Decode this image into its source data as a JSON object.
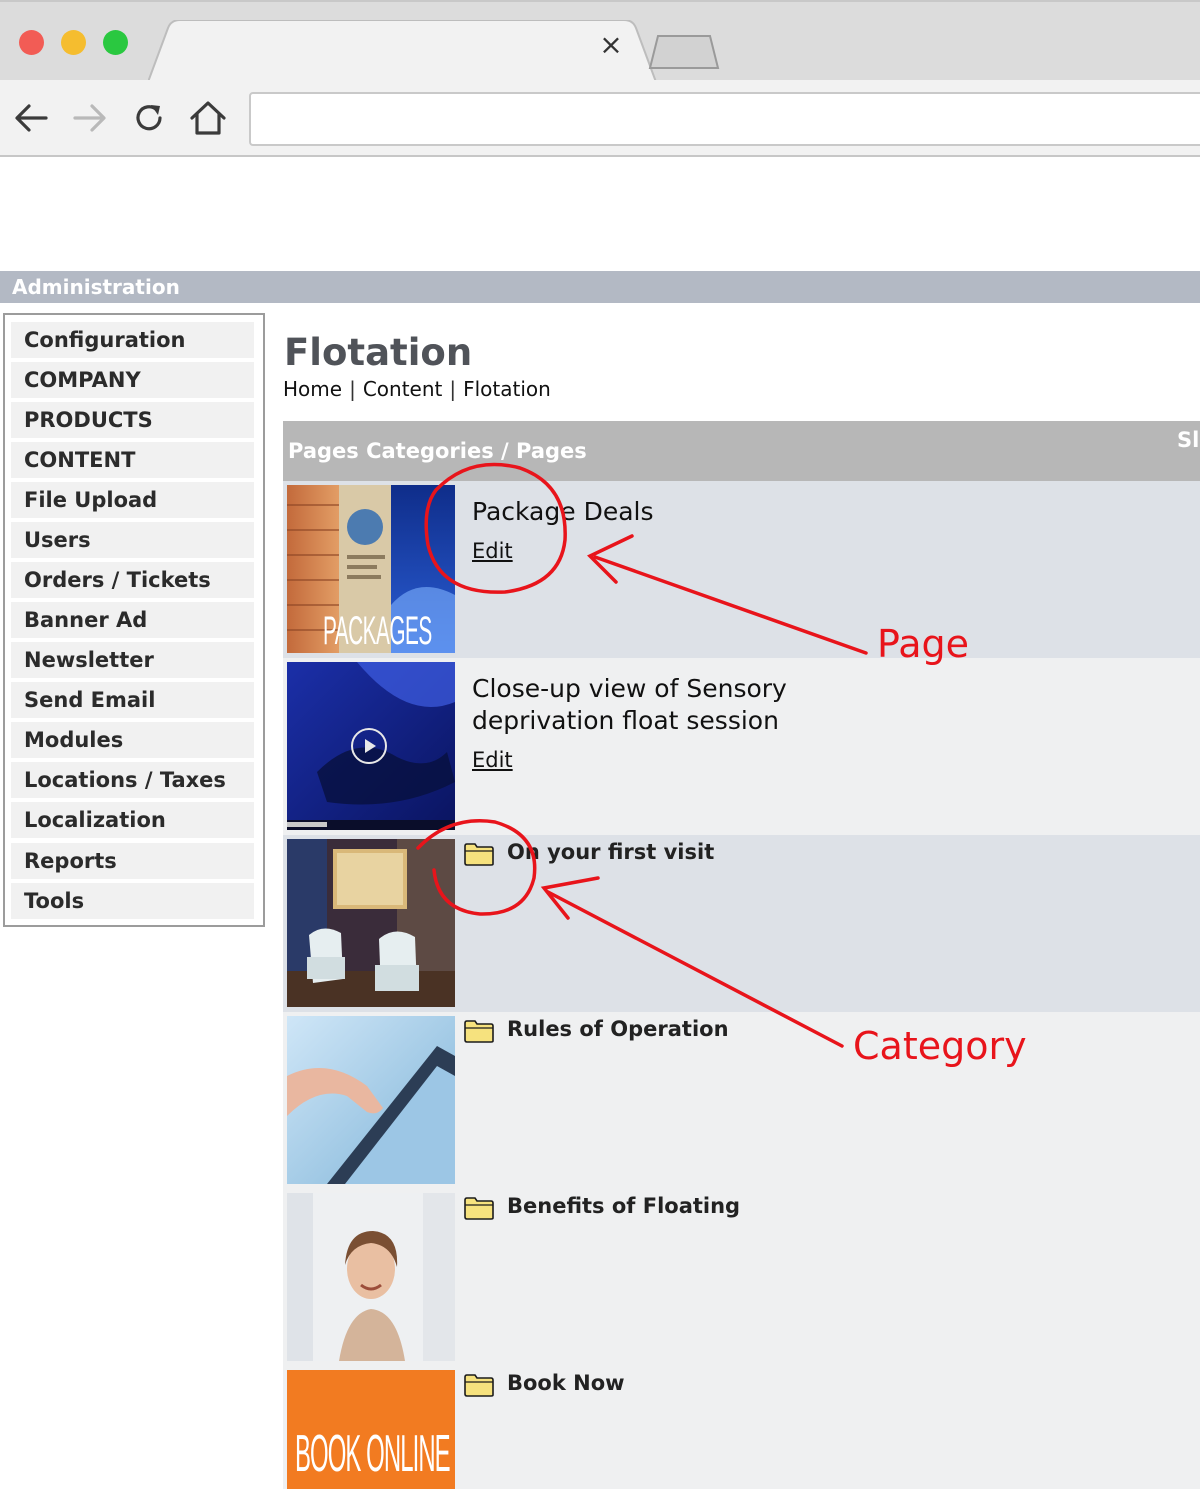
{
  "admin": {
    "title": "Administration"
  },
  "sidebar": {
    "items": [
      {
        "label": "Configuration"
      },
      {
        "label": "COMPANY"
      },
      {
        "label": "PRODUCTS"
      },
      {
        "label": "CONTENT"
      },
      {
        "label": "File Upload"
      },
      {
        "label": "Users"
      },
      {
        "label": "Orders / Tickets"
      },
      {
        "label": "Banner Ad"
      },
      {
        "label": "Newsletter"
      },
      {
        "label": "Send Email"
      },
      {
        "label": "Modules"
      },
      {
        "label": "Locations / Taxes"
      },
      {
        "label": "Localization"
      },
      {
        "label": "Reports"
      },
      {
        "label": "Tools"
      }
    ]
  },
  "main": {
    "title": "Flotation",
    "breadcrumb": [
      "Home",
      "Content",
      "Flotation"
    ],
    "list_header": "Pages Categories / Pages",
    "list_header_extra": "Sl",
    "pages": [
      {
        "title": "Package Deals",
        "edit_label": "Edit",
        "thumb_text": "PACKAGES"
      },
      {
        "title": "Close-up view of Sensory deprivation float session",
        "edit_label": "Edit"
      }
    ],
    "categories": [
      {
        "title": "On your first visit"
      },
      {
        "title": "Rules of Operation"
      },
      {
        "title": "Benefits of Floating"
      },
      {
        "title": "Book Now",
        "thumb_text": "BOOK ONLINE NOW"
      }
    ]
  },
  "annotations": {
    "page_label": "Page",
    "category_label": "Category",
    "color": "#e8141b"
  }
}
